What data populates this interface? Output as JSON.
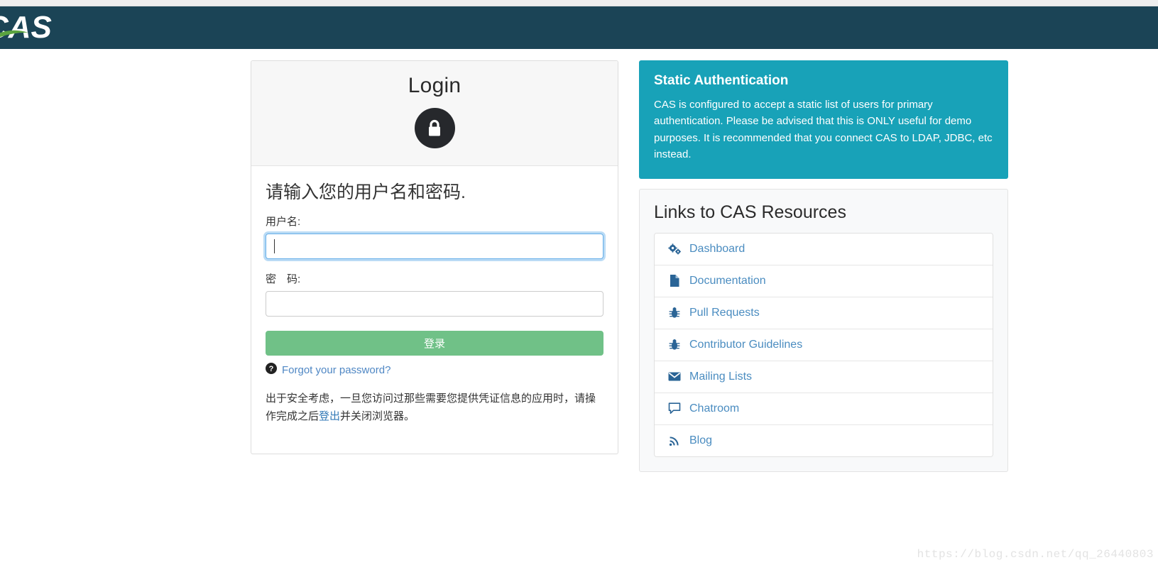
{
  "header": {
    "logo_text": "CAS",
    "background_color": "#1b4456",
    "logo_swoosh_color": "#5aa33f"
  },
  "login_card": {
    "title": "Login",
    "lock_icon": "padlock-icon",
    "prompt": "请输入您的用户名和密码.",
    "username": {
      "label": "用户名:",
      "value": "",
      "placeholder": "",
      "focused": true
    },
    "password": {
      "label": "密　码:",
      "value": "",
      "placeholder": ""
    },
    "submit_label": "登录",
    "submit_color": "#70c187",
    "forgot_icon": "question-circle-icon",
    "forgot_label": "Forgot your password?",
    "security_notice_before": "出于安全考虑，一旦您访问过那些需要您提供凭证信息的应用时，请操作完成之后",
    "security_notice_link": "登出",
    "security_notice_after": "并关闭浏览器。"
  },
  "info_panel": {
    "title": "Static Authentication",
    "body": "CAS is configured to accept a static list of users for primary authentication. Please be advised that this is ONLY useful for demo purposes. It is recommended that you connect CAS to LDAP, JDBC, etc instead.",
    "background_color": "#18a2b8"
  },
  "links_panel": {
    "title": "Links to CAS Resources",
    "items": [
      {
        "label": "Dashboard",
        "icon": "cogs-icon"
      },
      {
        "label": "Documentation",
        "icon": "file-icon"
      },
      {
        "label": "Pull Requests",
        "icon": "bug-icon"
      },
      {
        "label": "Contributor Guidelines",
        "icon": "bug-icon"
      },
      {
        "label": "Mailing Lists",
        "icon": "envelope-icon"
      },
      {
        "label": "Chatroom",
        "icon": "comment-icon"
      },
      {
        "label": "Blog",
        "icon": "rss-icon"
      }
    ],
    "link_color": "#4a8cc0"
  },
  "watermark": {
    "text": "https://blog.csdn.net/qq_26440803"
  }
}
